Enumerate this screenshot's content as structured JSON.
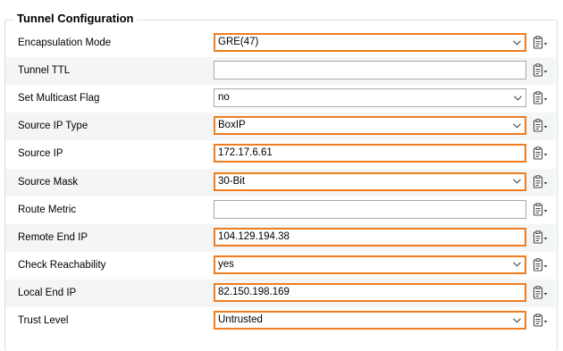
{
  "section": {
    "title": "Tunnel Configuration"
  },
  "colors": {
    "highlight_border": "#f07c1d",
    "alt_row": "#f3f5f7"
  },
  "rows": [
    {
      "label": "Encapsulation Mode",
      "type": "select",
      "value": "GRE(47)",
      "highlighted": true
    },
    {
      "label": "Tunnel TTL",
      "type": "text",
      "value": "",
      "highlighted": false
    },
    {
      "label": "Set Multicast Flag",
      "type": "select",
      "value": "no",
      "highlighted": false
    },
    {
      "label": "Source IP Type",
      "type": "select",
      "value": "BoxIP",
      "highlighted": true
    },
    {
      "label": "Source IP",
      "type": "text",
      "value": "172.17.6.61",
      "highlighted": true
    },
    {
      "label": "Source Mask",
      "type": "select",
      "value": "30-Bit",
      "highlighted": true
    },
    {
      "label": "Route Metric",
      "type": "text",
      "value": "",
      "highlighted": false
    },
    {
      "label": "Remote End IP",
      "type": "text",
      "value": "104.129.194.38",
      "highlighted": true
    },
    {
      "label": "Check Reachability",
      "type": "select",
      "value": "yes",
      "highlighted": true
    },
    {
      "label": "Local End IP",
      "type": "text",
      "value": "82.150.198.169",
      "highlighted": true
    },
    {
      "label": "Trust Level",
      "type": "select",
      "value": "Untrusted",
      "highlighted": true
    }
  ],
  "icons": {
    "row_menu": "clipboard-menu-icon",
    "dropdown": "chevron-down-icon"
  }
}
